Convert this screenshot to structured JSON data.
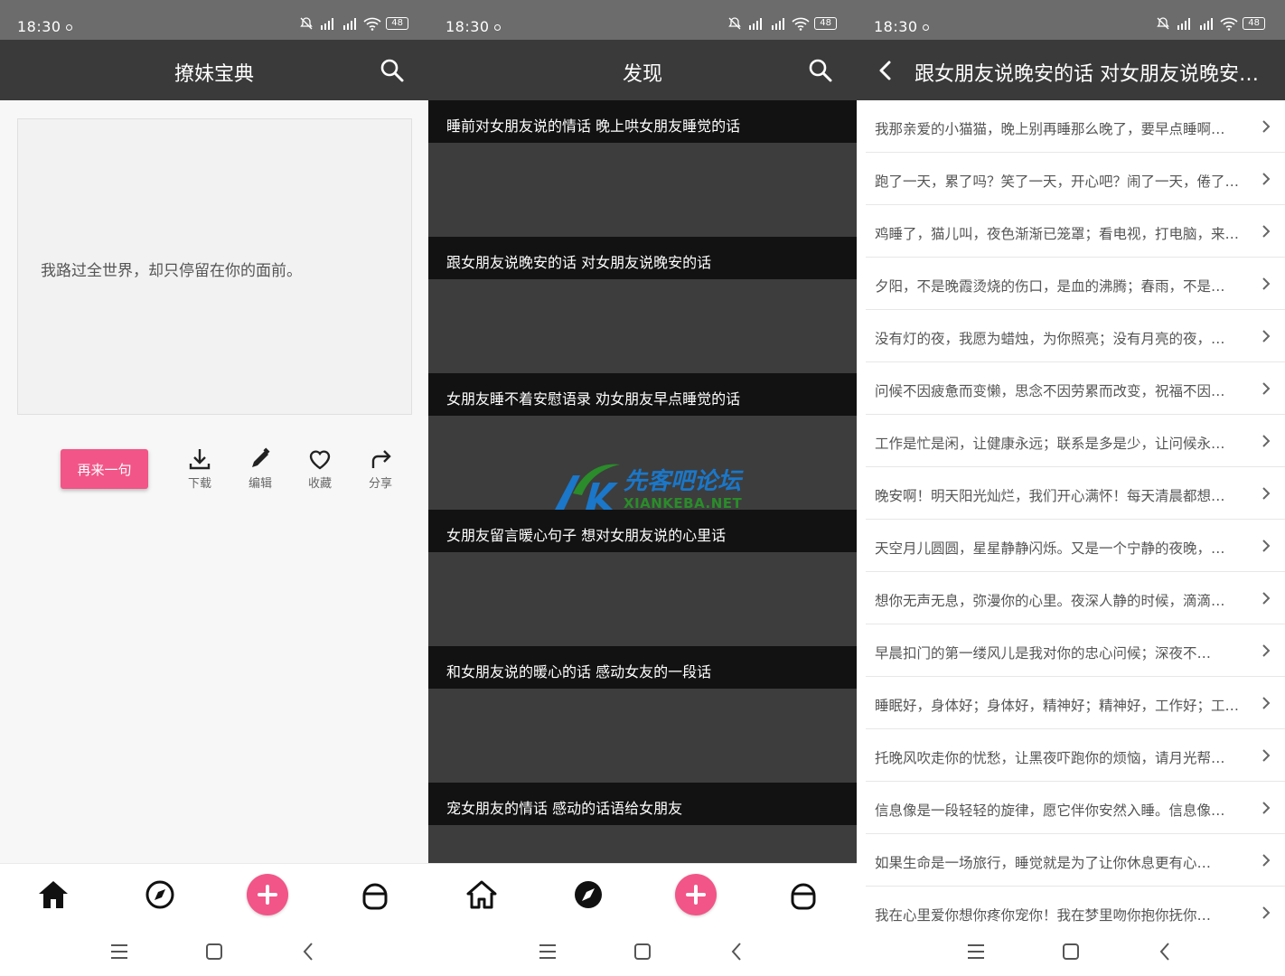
{
  "status_bar": {
    "time": "18:30",
    "battery": "48"
  },
  "screen_home": {
    "title": "撩妹宝典",
    "quote": "我路过全世界，却只停留在你的面前。",
    "next_button": "再来一句",
    "actions": [
      {
        "label": "下载",
        "icon": "download-icon"
      },
      {
        "label": "编辑",
        "icon": "edit-icon"
      },
      {
        "label": "收藏",
        "icon": "heart-icon"
      },
      {
        "label": "分享",
        "icon": "share-icon"
      }
    ]
  },
  "screen_discover": {
    "title": "发现",
    "cards": [
      {
        "title": "睡前对女朋友说的情话 晚上哄女朋友睡觉的话"
      },
      {
        "title": "跟女朋友说晚安的话 对女朋友说晚安的话"
      },
      {
        "title": "女朋友睡不着安慰语录 劝女朋友早点睡觉的话"
      },
      {
        "title": "女朋友留言暖心句子 想对女朋友说的心里话"
      },
      {
        "title": "和女朋友说的暖心的话 感动女友的一段话"
      },
      {
        "title": "宠女朋友的情话 感动的话语给女朋友"
      }
    ]
  },
  "screen_detail": {
    "title": "跟女朋友说晚安的话 对女朋友说晚安的话",
    "items": [
      "我那亲爱的小猫猫，晚上别再睡那么晚了，要早点睡啊…",
      "跑了一天，累了吗？笑了一天，开心吧？闹了一天，倦了…",
      "鸡睡了，猫儿叫，夜色渐渐已笼罩；看电视，打电脑，来…",
      "夕阳，不是晚霞烫烧的伤口，是血的沸腾；春雨，不是…",
      "没有灯的夜，我愿为蜡烛，为你照亮；没有月亮的夜，…",
      "问候不因疲惫而变懒，思念不因劳累而改变，祝福不因…",
      "工作是忙是闲，让健康永远；联系是多是少，让问候永…",
      "晚安啊！明天阳光灿烂，我们开心满怀！每天清晨都想…",
      "天空月儿圆圆，星星静静闪烁。又是一个宁静的夜晚，…",
      "想你无声无息，弥漫你的心里。夜深人静的时候，滴滴…",
      "早晨扣门的第一缕风儿是我对你的忠心问候；深夜不…",
      "睡眠好，身体好；身体好，精神好；精神好，工作好；工…",
      "托晚风吹走你的忧愁，让黑夜吓跑你的烦恼，请月光帮…",
      "信息像是一段轻轻的旋律，愿它伴你安然入睡。信息像…",
      "如果生命是一场旅行，睡觉就是为了让你休息更有心…",
      "我在心里爱你想你疼你宠你！我在梦里吻你抱你抚你…"
    ]
  },
  "watermark": {
    "cn": "先客吧论坛",
    "en": "XIANKEBA.NET"
  },
  "colors": {
    "accent": "#f25588",
    "appbar": "#3a3a3a",
    "statusbar": "#6c6c6c"
  }
}
